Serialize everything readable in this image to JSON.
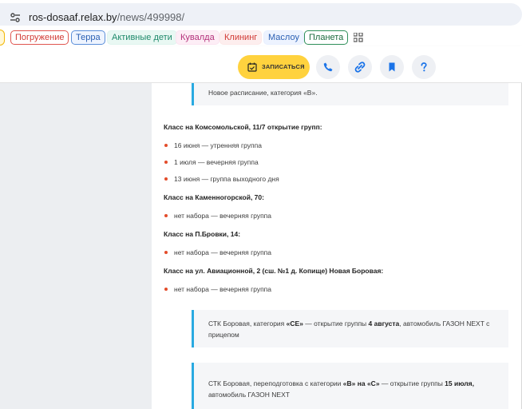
{
  "browser": {
    "url_host": "ros-dosaaf.relax.by",
    "url_path": "/news/499998/"
  },
  "bookmarks": [
    {
      "label": "Погружение",
      "border": "#e0554f",
      "text": "#d23b35",
      "bg": "#ffffff"
    },
    {
      "label": "Терра",
      "border": "#5b8fd9",
      "text": "#2a5fb3",
      "bg": "#eef4ff"
    },
    {
      "label": "Активные дети",
      "border": "#dff4ee",
      "text": "#1f8a6b",
      "bg": "#e9f8f3"
    },
    {
      "label": "Кувалда",
      "border": "#fbe4f1",
      "text": "#b4307b",
      "bg": "#fdeef6"
    },
    {
      "label": "Клининг",
      "border": "#fde7e7",
      "text": "#d23b35",
      "bg": "#fdeeee"
    },
    {
      "label": "Маслоу",
      "border": "#e7efff",
      "text": "#2a5fb3",
      "bg": "#edf3ff"
    },
    {
      "label": "Планета",
      "border": "#2f8f5a",
      "text": "#1b6b3e",
      "bg": "#ffffff"
    }
  ],
  "toolbar": {
    "sign_up_label": "ЗАПИСАТЬСЯ",
    "accent": "#ffd23e",
    "icon_color": "#1a73e8"
  },
  "article": {
    "top_note": "Новое расписание, категория «В».",
    "sections": [
      {
        "heading": "Класс на Комсомольской, 11/7 открытие групп:",
        "items": [
          "16 июня — утренняя группа",
          "1 июля — вечерняя группа",
          "13 июня — группа выходного дня"
        ]
      },
      {
        "heading": "Класс на Каменногорской, 70:",
        "items": [
          "нет набора — вечерняя группа"
        ]
      },
      {
        "heading": "Класс на П.Бровки, 14:",
        "items": [
          "нет набора — вечерняя группа"
        ]
      },
      {
        "heading": "Класс на ул. Авиационной, 2 (сш. №1 д. Копище) Новая Боровая:",
        "items": [
          "нет набора — вечерняя группа"
        ]
      }
    ],
    "note_ce": {
      "part1": "СТК Боровая, категория ",
      "bold1": "«СЕ»",
      "part2": " — открытие группы ",
      "bold2": "4 августа",
      "part3": ", автомобиль ГАЗОН NEXT с прицепом"
    },
    "note_bc": {
      "part1": "СТК Боровая, переподготовка с категории ",
      "bold1": "«В» на «С»",
      "part2": " — открытие группы ",
      "bold2": "15 июля,",
      "part3": " автомобиль ГАЗОН NEXT"
    }
  }
}
